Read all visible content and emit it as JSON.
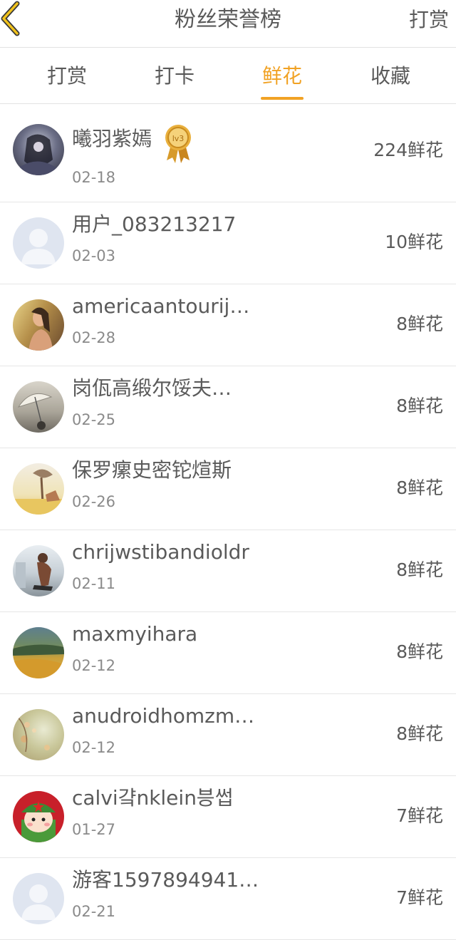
{
  "header": {
    "title": "粉丝荣誉榜",
    "action_label": "打赏",
    "accent_color": "#f1a224"
  },
  "tabs": [
    {
      "label": "打赏",
      "active": false
    },
    {
      "label": "打卡",
      "active": false
    },
    {
      "label": "鲜花",
      "active": true
    },
    {
      "label": "收藏",
      "active": false
    }
  ],
  "badge": {
    "text": "lv3"
  },
  "fans": [
    {
      "name": "曦羽紫嫣",
      "date": "02-18",
      "amount": "224鲜花",
      "avatar": "dark-anime-avatar",
      "has_badge": true
    },
    {
      "name": "用户_083213217",
      "date": "02-03",
      "amount": "10鲜花",
      "avatar": "default-user-avatar"
    },
    {
      "name": "americaantourij…",
      "date": "02-28",
      "amount": "8鲜花",
      "avatar": "photo-avatar"
    },
    {
      "name": "岗佤高缎尔馁夫…",
      "date": "02-25",
      "amount": "8鲜花",
      "avatar": "umbrella-avatar"
    },
    {
      "name": "保罗瘰史密铊煊斯",
      "date": "02-26",
      "amount": "8鲜花",
      "avatar": "landscape-avatar"
    },
    {
      "name": "chrijwstibandioldr",
      "date": "02-11",
      "amount": "8鲜花",
      "avatar": "runner-avatar"
    },
    {
      "name": "maxmyihara",
      "date": "02-12",
      "amount": "8鲜花",
      "avatar": "field-avatar"
    },
    {
      "name": "anudroidhomzm…",
      "date": "02-12",
      "amount": "8鲜花",
      "avatar": "blossom-avatar"
    },
    {
      "name": "calvi걐nklein븡썹",
      "date": "01-27",
      "amount": "7鲜花",
      "avatar": "cartoon-soldier-avatar"
    },
    {
      "name": "游客1597894941…",
      "date": "02-21",
      "amount": "7鲜花",
      "avatar": "default-user-avatar"
    }
  ]
}
